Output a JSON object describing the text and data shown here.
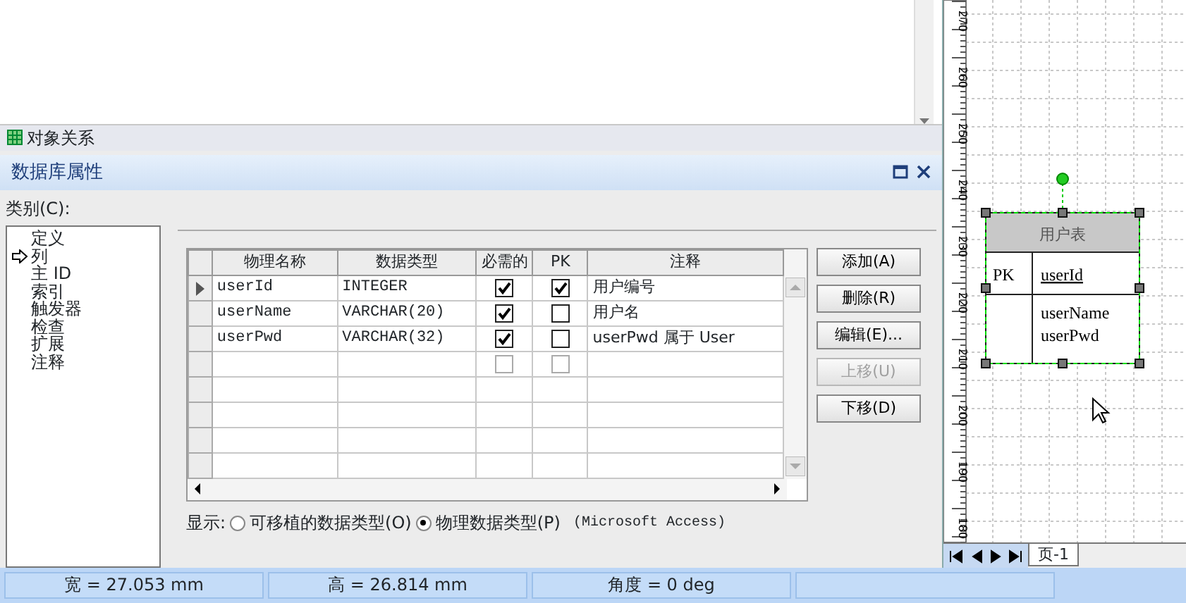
{
  "relations_bar": {
    "title": "对象关系"
  },
  "panel": {
    "title": "数据库属性",
    "category_label": "类别(C):"
  },
  "categories": [
    {
      "label": "定义",
      "selected": false
    },
    {
      "label": "列",
      "selected": true
    },
    {
      "label": "主 ID",
      "selected": false
    },
    {
      "label": "索引",
      "selected": false
    },
    {
      "label": "触发器",
      "selected": false
    },
    {
      "label": "检查",
      "selected": false
    },
    {
      "label": "扩展",
      "selected": false
    },
    {
      "label": "注释",
      "selected": false
    }
  ],
  "table": {
    "columns": [
      "物理名称",
      "数据类型",
      "必需的",
      "PK",
      "注释"
    ],
    "rows": [
      {
        "kind": "data",
        "selected": true,
        "name": "userId",
        "type": "INTEGER",
        "required": true,
        "pk": true,
        "comment": "用户编号"
      },
      {
        "kind": "data",
        "selected": false,
        "name": "userName",
        "type": "VARCHAR(20)",
        "required": true,
        "pk": false,
        "comment": "用户名"
      },
      {
        "kind": "data",
        "selected": false,
        "name": "userPwd",
        "type": "VARCHAR(32)",
        "required": true,
        "pk": false,
        "comment": "userPwd 属于 User"
      },
      {
        "kind": "new",
        "selected": false,
        "required": false,
        "pk": false
      },
      {
        "kind": "empty",
        "selected": false
      },
      {
        "kind": "empty",
        "selected": false
      },
      {
        "kind": "empty",
        "selected": false
      },
      {
        "kind": "empty",
        "selected": false
      }
    ]
  },
  "buttons": [
    {
      "label": "添加(A)",
      "disabled": false
    },
    {
      "label": "删除(R)",
      "disabled": false
    },
    {
      "label": "编辑(E)...",
      "disabled": false
    },
    {
      "label": "上移(U)",
      "disabled": true
    },
    {
      "label": "下移(D)",
      "disabled": false
    }
  ],
  "display": {
    "label": "显示:",
    "options": [
      {
        "label": "可移植的数据类型(O)",
        "selected": false
      },
      {
        "label": "物理数据类型(P)",
        "selected": true
      }
    ],
    "note": "(Microsoft Access)"
  },
  "ruler_labels": [
    "270",
    "260",
    "250",
    "240",
    "230",
    "220",
    "210",
    "200",
    "190",
    "180"
  ],
  "entity": {
    "title": "用户表",
    "key_label": "PK",
    "key_field": "userId",
    "fields": [
      "userName",
      "userPwd"
    ]
  },
  "page_tab": "页-1",
  "status_bar": [
    "宽 = 27.053 mm",
    "高 = 26.814 mm",
    "角度 = 0 deg"
  ]
}
